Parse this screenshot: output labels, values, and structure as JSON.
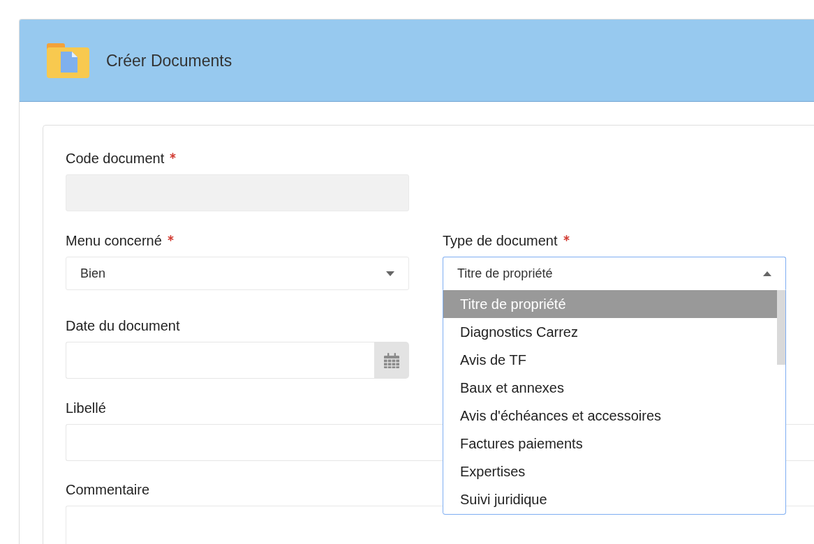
{
  "window": {
    "title": "Créer Documents"
  },
  "form": {
    "grid_rows": [
      {
        "fields": [
          {
            "kind": "text",
            "label": "Code document",
            "required": true,
            "disabled": true
          }
        ]
      },
      {
        "fields": [
          {
            "kind": "select",
            "label": "Menu concerné",
            "required": true,
            "value": "Bien",
            "expanded": false
          },
          {
            "kind": "select",
            "label": "Type de document",
            "required": true,
            "value": "Titre de propriété",
            "expanded": true,
            "options": [
              {
                "label": "Titre de propriété",
                "selected": true
              },
              {
                "label": "Diagnostics Carrez",
                "selected": false
              },
              {
                "label": "Avis de TF",
                "selected": false
              },
              {
                "label": "Baux et annexes",
                "selected": false
              },
              {
                "label": "Avis d'échéances et accessoires",
                "selected": false
              },
              {
                "label": "Factures paiements",
                "selected": false
              },
              {
                "label": "Expertises",
                "selected": false
              },
              {
                "label": "Suivi juridique",
                "selected": false
              }
            ]
          }
        ]
      },
      {
        "fields": [
          {
            "kind": "date",
            "label": "Date du document",
            "required": false
          }
        ]
      }
    ],
    "wide_fields": [
      {
        "kind": "text",
        "label": "Libellé",
        "required": false,
        "disabled": false
      },
      {
        "kind": "textarea",
        "label": "Commentaire",
        "required": false
      }
    ]
  }
}
